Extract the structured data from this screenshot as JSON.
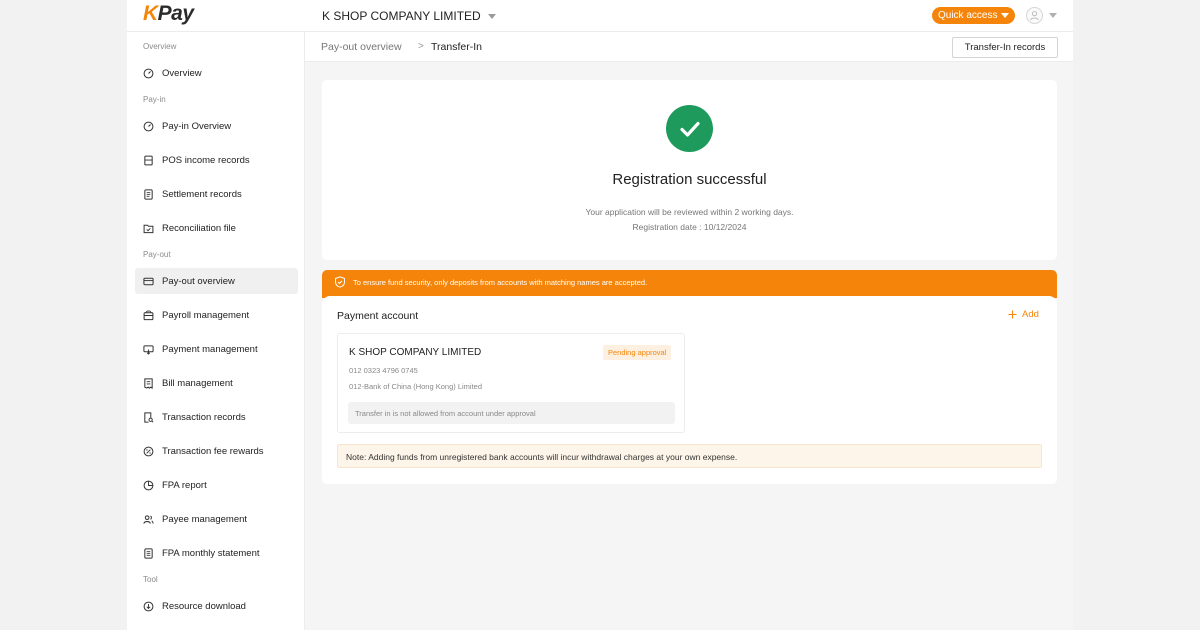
{
  "header": {
    "logo": "KPay",
    "company": "K SHOP COMPANY LIMITED",
    "quick_access": "Quick access"
  },
  "sidebar": {
    "sections": [
      {
        "label": "Overview",
        "items": [
          {
            "label": "Overview",
            "icon": "dashboard-icon"
          }
        ]
      },
      {
        "label": "Pay-in",
        "items": [
          {
            "label": "Pay-in Overview",
            "icon": "dashboard-icon"
          },
          {
            "label": "POS income records",
            "icon": "pos-terminal-icon"
          },
          {
            "label": "Settlement records",
            "icon": "document-icon"
          },
          {
            "label": "Reconciliation file",
            "icon": "folder-check-icon"
          }
        ]
      },
      {
        "label": "Pay-out",
        "items": [
          {
            "label": "Pay-out overview",
            "icon": "card-icon",
            "active": true
          },
          {
            "label": "Payroll management",
            "icon": "wallet-icon"
          },
          {
            "label": "Payment management",
            "icon": "payment-icon"
          },
          {
            "label": "Bill management",
            "icon": "bill-icon"
          },
          {
            "label": "Transaction records",
            "icon": "search-document-icon"
          },
          {
            "label": "Transaction fee rewards",
            "icon": "percent-icon"
          },
          {
            "label": "FPA report",
            "icon": "pie-chart-icon"
          },
          {
            "label": "Payee management",
            "icon": "users-icon"
          },
          {
            "label": "FPA monthly statement",
            "icon": "statement-icon"
          }
        ]
      },
      {
        "label": "Tool",
        "items": [
          {
            "label": "Resource download",
            "icon": "download-icon"
          }
        ]
      }
    ]
  },
  "breadcrumb": {
    "parent": "Pay-out overview",
    "separator": ">",
    "current": "Transfer-In",
    "records_button": "Transfer-In records"
  },
  "success": {
    "title": "Registration successful",
    "line1": "Your application will be reviewed within 2 working days.",
    "line2": "Registration date : 10/12/2024"
  },
  "payment": {
    "notice": "To ensure fund security, only deposits from accounts with matching names are accepted.",
    "title": "Payment account",
    "add": "Add",
    "account": {
      "name": "K SHOP COMPANY LIMITED",
      "status": "Pending approval",
      "number": "012 0323 4796 0745",
      "bank": "012-Bank of China (Hong Kong) Limited",
      "warning": "Transfer in is not allowed from account under approval"
    },
    "note": "Note: Adding funds from unregistered bank accounts will incur withdrawal charges at your own expense."
  },
  "colors": {
    "accent": "#f5850a",
    "success": "#1f9a5d"
  }
}
